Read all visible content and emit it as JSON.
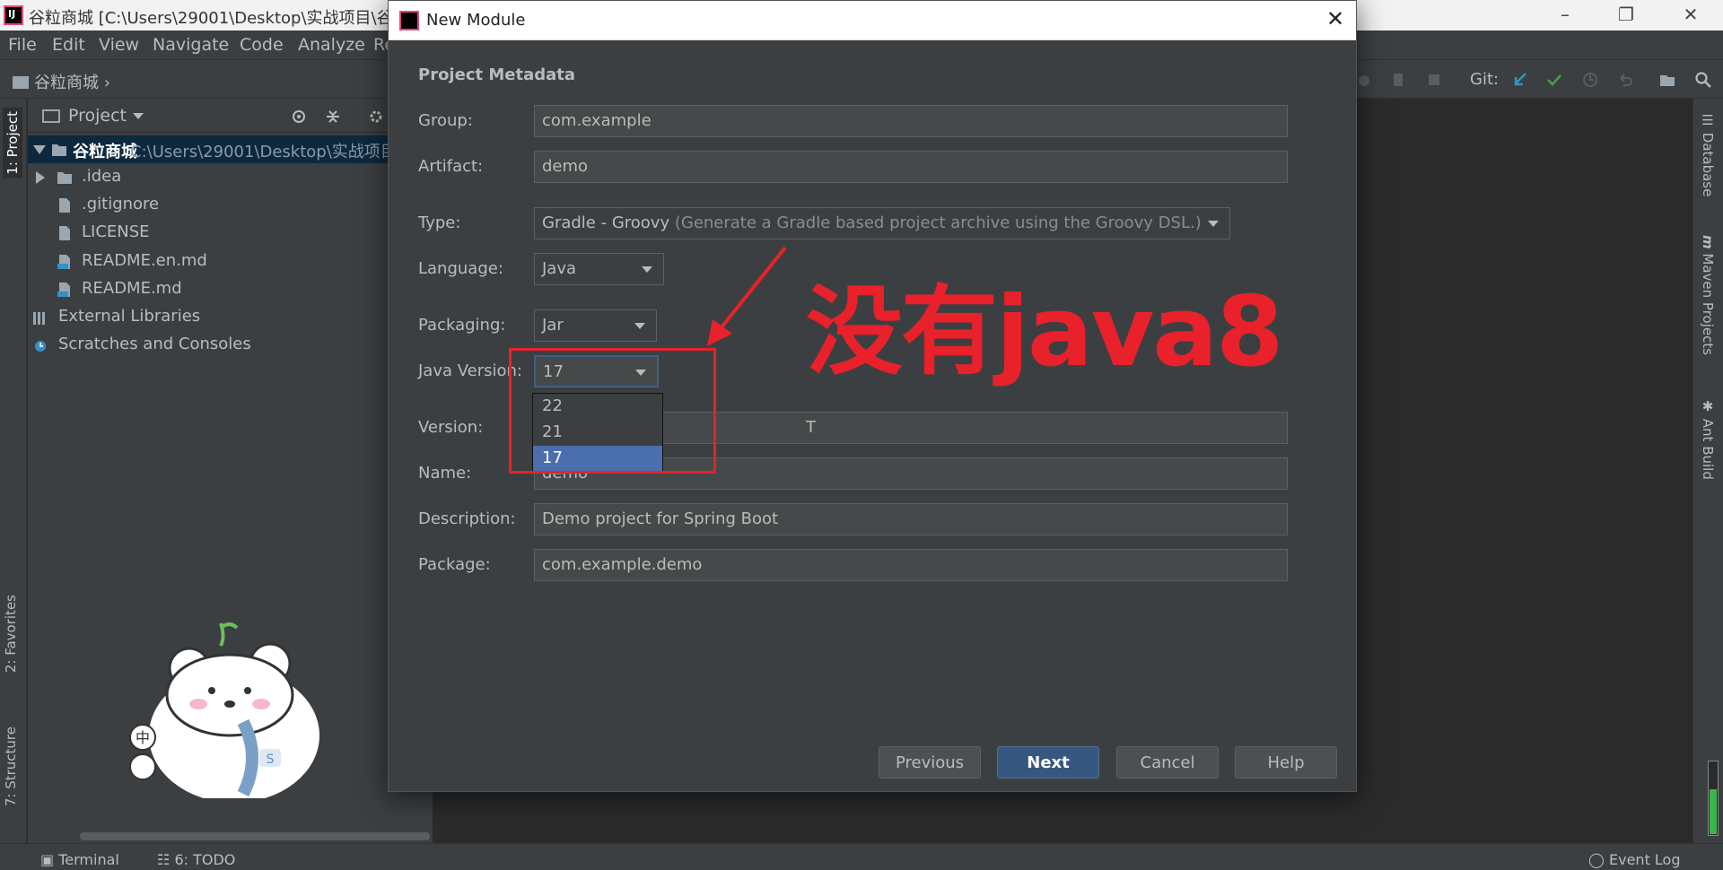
{
  "window": {
    "title": "谷粒商城 [C:\\Users\\29001\\Desktop\\实战项目\\谷粒"
  },
  "menu": [
    "File",
    "Edit",
    "View",
    "Navigate",
    "Code",
    "Analyze",
    "Re"
  ],
  "breadcrumb": "谷粒商城",
  "toolbar": {
    "git_label": "Git:"
  },
  "left_tabs": {
    "project": "1: Project",
    "favorites": "2: Favorites",
    "structure": "7: Structure"
  },
  "right_tabs": {
    "database": "Database",
    "maven": "Maven Projects",
    "ant": "Ant Build"
  },
  "project_panel": {
    "title": "Project",
    "root_name": "谷粒商城",
    "root_path": "C:\\Users\\29001\\Desktop\\实战项目",
    "items": [
      ".idea",
      ".gitignore",
      "LICENSE",
      "README.en.md",
      "README.md",
      "External Libraries",
      "Scratches and Consoles"
    ]
  },
  "bottom_bar": {
    "terminal": "Terminal",
    "todo": "6: TODO",
    "event_log": "Event Log"
  },
  "sticker_chars": {
    "top": "中",
    "bottom": "S"
  },
  "dialog": {
    "title": "New Module",
    "section": "Project Metadata",
    "labels": {
      "group": "Group:",
      "artifact": "Artifact:",
      "type": "Type:",
      "language": "Language:",
      "packaging": "Packaging:",
      "java_version": "Java Version:",
      "version": "Version:",
      "name": "Name:",
      "description": "Description:",
      "package": "Package:"
    },
    "values": {
      "group": "com.example",
      "artifact": "demo",
      "type": "Gradle - Groovy",
      "type_hint": "(Generate a Gradle based project archive using the Groovy DSL.)",
      "language": "Java",
      "packaging": "Jar",
      "java_version": "17",
      "version_visible": "T",
      "name": "demo",
      "description": "Demo project for Spring Boot",
      "package": "com.example.demo"
    },
    "java_version_options": [
      "22",
      "21",
      "17"
    ],
    "java_version_selected": "17",
    "buttons": {
      "previous": "Previous",
      "next": "Next",
      "cancel": "Cancel",
      "help": "Help"
    }
  },
  "annotation": {
    "text": "没有java8",
    "color": "#e8212b"
  }
}
